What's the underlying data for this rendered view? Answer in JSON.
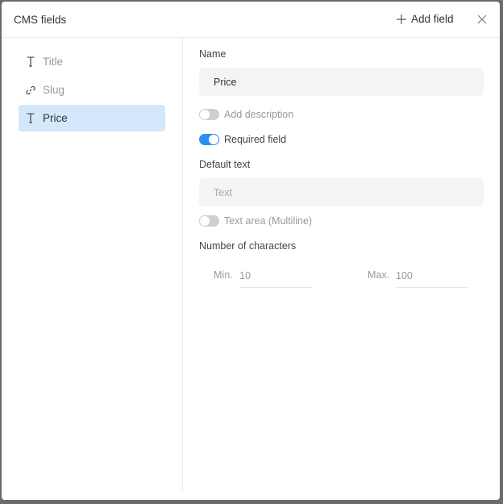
{
  "header": {
    "title": "CMS fields",
    "add_label": "Add field",
    "add_icon": "plus-icon",
    "close_icon": "close-icon"
  },
  "sidebar": {
    "items": [
      {
        "label": "Title",
        "icon": "text-type-icon",
        "selected": false
      },
      {
        "label": "Slug",
        "icon": "link-icon",
        "selected": false
      },
      {
        "label": "Price",
        "icon": "text-type-icon",
        "selected": true
      }
    ]
  },
  "form": {
    "name_label": "Name",
    "name_value": "Price",
    "add_description": {
      "label": "Add description",
      "on": false
    },
    "required": {
      "label": "Required field",
      "on": true
    },
    "default_label": "Default text",
    "default_placeholder": "Text",
    "multiline": {
      "label": "Text area (Multiline)",
      "on": false
    },
    "chars_label": "Number of characters",
    "min_label": "Min.",
    "min_value": "10",
    "max_label": "Max.",
    "max_value": "100"
  },
  "colors": {
    "accent": "#2f8ff0",
    "selected_bg": "#d3e8fb"
  }
}
